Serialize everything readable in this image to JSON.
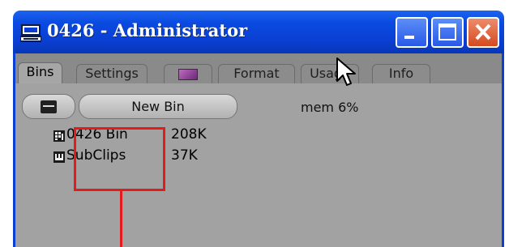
{
  "window": {
    "title": "0426 - Administrator",
    "accent": "#0a3fd2",
    "buttons": {
      "minimize": "minimize-icon",
      "maximize": "maximize-icon",
      "close": "close-icon"
    }
  },
  "tabs": [
    {
      "label": "Bins",
      "active": true
    },
    {
      "label": "Settings",
      "active": false
    },
    {
      "label": "",
      "icon": "color-swatch-icon",
      "active": false
    },
    {
      "label": "Format",
      "active": false
    },
    {
      "label": "Usage",
      "active": false
    },
    {
      "label": "Info",
      "active": false
    }
  ],
  "toolbar": {
    "menu_icon": "menu-icon",
    "new_bin_label": "New Bin",
    "memory_label": "mem 6%"
  },
  "bins": [
    {
      "name": "0426 Bin",
      "size": "208K",
      "icon": "bin-icon"
    },
    {
      "name": "SubClips",
      "size": "37K",
      "icon": "subclips-icon"
    }
  ],
  "annotation": {
    "color": "#e31b1b"
  }
}
